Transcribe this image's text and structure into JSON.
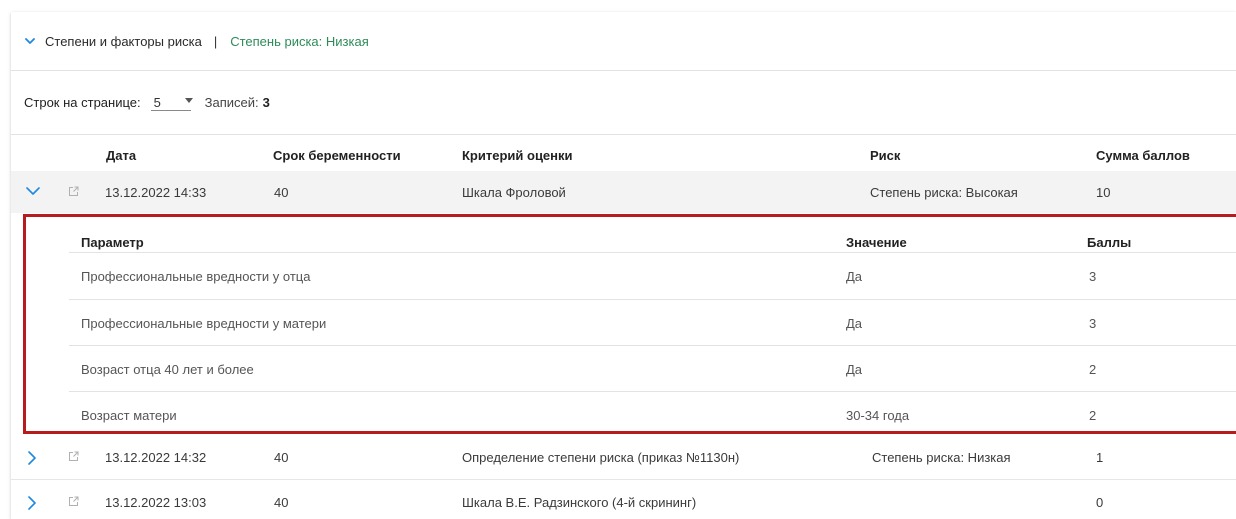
{
  "header": {
    "title": "Степени и факторы риска",
    "separator": "|",
    "risk_label": "Степень риска: Низкая",
    "risk_color": "#2e8b57"
  },
  "pagination": {
    "rows_label": "Строк на странице:",
    "rows_value": "5",
    "records_label": "Записей:",
    "records_count": "3"
  },
  "table": {
    "columns": [
      "Дата",
      "Срок беременности",
      "Критерий оценки",
      "Риск",
      "Сумма баллов"
    ],
    "rows": [
      {
        "date": "13.12.2022 14:33",
        "term": "40",
        "criterion": "Шкала Фроловой",
        "risk": "Степень риска: Высокая",
        "score": "10",
        "expanded": true
      },
      {
        "date": "13.12.2022 14:32",
        "term": "40",
        "criterion": "Определение степени риска (приказ №1130н)",
        "risk": "Степень риска: Низкая",
        "score": "1",
        "expanded": false
      },
      {
        "date": "13.12.2022 13:03",
        "term": "40",
        "criterion": "Шкала В.Е. Радзинского (4-й скрининг)",
        "risk": "",
        "score": "0",
        "expanded": false
      }
    ]
  },
  "details": {
    "columns": [
      "Параметр",
      "Значение",
      "Баллы"
    ],
    "rows": [
      {
        "param": "Профессиональные вредности у отца",
        "value": "Да",
        "points": "3"
      },
      {
        "param": "Профессиональные вредности у матери",
        "value": "Да",
        "points": "3"
      },
      {
        "param": "Возраст отца 40 лет и более",
        "value": "Да",
        "points": "2"
      },
      {
        "param": "Возраст матери",
        "value": "30-34 года",
        "points": "2"
      }
    ],
    "highlight_color": "#b71c1c"
  },
  "colors": {
    "accent": "#1e88e5"
  }
}
